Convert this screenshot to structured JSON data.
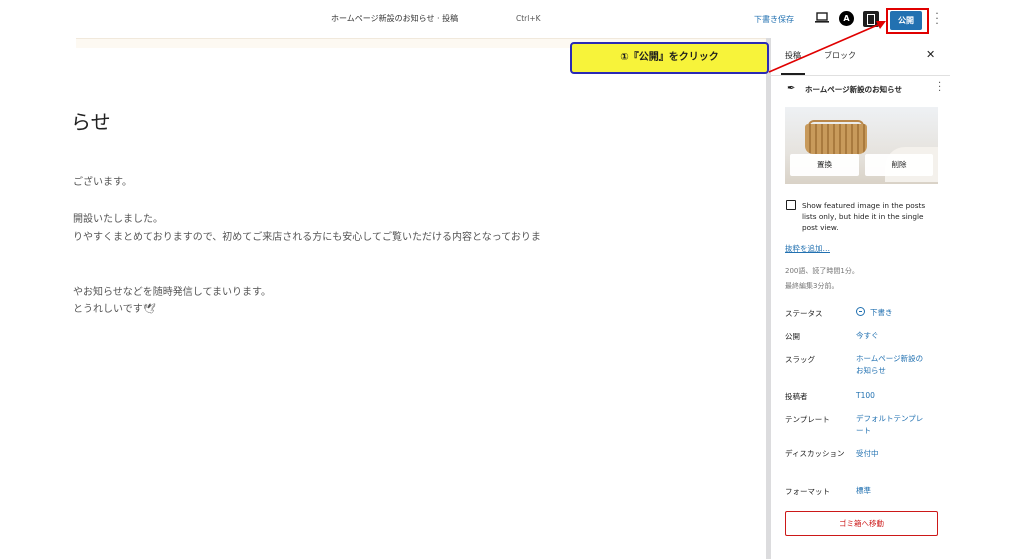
{
  "header": {
    "doc_title": "ホームページ新設のお知らせ · 投稿",
    "shortcut": "Ctrl+K",
    "save_draft": "下書き保存",
    "astra_logo": "A",
    "publish": "公開"
  },
  "annotation": {
    "text": "①『公開』をクリック",
    "colors": {
      "box": "#f7f33a",
      "border": "#2a2ab5",
      "arrow": "#e00000"
    }
  },
  "editor": {
    "heading": "らせ",
    "paragraphs": [
      "ございます。",
      "開設いたしました。",
      "りやすくまとめておりますので、初めてご来店される方にも安心してご覧いただける内容となっておりま",
      "やお知らせなどを随時発信してまいります。",
      "とうれしいです🕊"
    ]
  },
  "sidebar": {
    "tabs": [
      "投稿",
      "ブロック"
    ],
    "post_name": "ホームページ新設のお知らせ",
    "image_buttons": {
      "replace": "置換",
      "remove": "削除"
    },
    "checkbox_label": "Show featured image in the posts lists only, but hide it in the single post view.",
    "excerpt_link": "抜粋を追加…",
    "meta": [
      "200語、読了時間1分。",
      "最終編集3分前。"
    ],
    "rows": [
      {
        "label": "ステータス",
        "value": "下書き"
      },
      {
        "label": "公開",
        "value": "今すぐ"
      },
      {
        "label": "スラッグ",
        "value": "ホームページ新設のお知らせ"
      },
      {
        "label": "投稿者",
        "value": "T100"
      },
      {
        "label": "テンプレート",
        "value": "デフォルトテンプレート"
      },
      {
        "label": "ディスカッション",
        "value": "受付中"
      },
      {
        "label": "フォーマット",
        "value": "標準"
      }
    ],
    "trash": "ゴミ箱へ移動"
  },
  "icons": [
    "preview-icon",
    "astra-icon",
    "settings-toggle-icon",
    "options-icon",
    "close-icon",
    "pen-icon",
    "kebab-icon",
    "status-draft-icon"
  ],
  "colors": {
    "accent": "#2271b1",
    "danger": "#cc1818"
  }
}
